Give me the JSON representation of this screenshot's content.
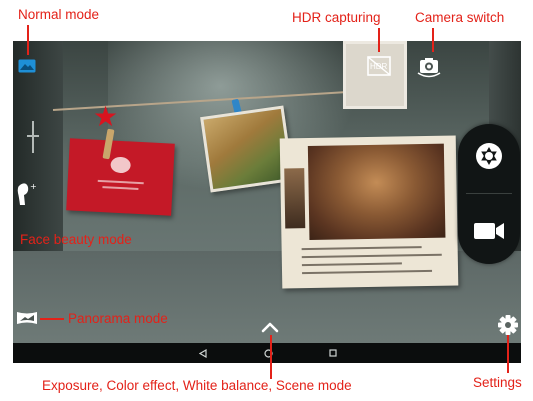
{
  "callouts": {
    "normal_mode": "Normal mode",
    "hdr_capturing": "HDR capturing",
    "camera_switch": "Camera switch",
    "face_beauty_mode": "Face beauty mode",
    "panorama_mode": "Panorama mode",
    "settings": "Settings",
    "bottom_caption": "Exposure, Color effect, White balance, Scene mode"
  },
  "camera_ui": {
    "hdr_badge": "HDR",
    "icons": {
      "normal_mode": "landscape-icon",
      "hdr": "hdr-icon",
      "camera_switch": "camera-switch-icon",
      "face_beauty": "face-beauty-icon",
      "panorama": "panorama-icon",
      "settings": "gear-icon",
      "expand": "chevron-up-icon",
      "shutter": "shutter-icon",
      "video": "video-camera-icon",
      "back": "back-icon",
      "home": "home-icon",
      "recents": "recents-icon"
    }
  },
  "colors": {
    "callout_text": "#e32219",
    "accent_blue": "#1e8fd6",
    "shutter_bg": "#111515",
    "nav_bg": "#0b0d0d"
  }
}
